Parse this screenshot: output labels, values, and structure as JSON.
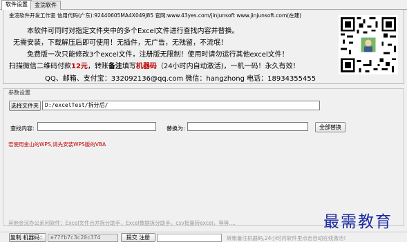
{
  "tabs": [
    {
      "label": "软件设置",
      "active": true
    },
    {
      "label": "金浣软件",
      "active": false
    }
  ],
  "info": {
    "header": "金浣软件开发工作室   信用代码(广东):92440605MA4X049J85  官网:www.43yes.com/jinjunsoft   www.jinjunsoft.com(在建)",
    "line1": "本软件可同时对指定文件夹中的多个Excel文件进行查找内容并替换。",
    "line2": "无需安装，下载解压后即可使用！无插件，无广告，无残留，不流氓！",
    "line3": "免费版一次只能修改3个excel文件，注册版无限制！使用时请勿运行其他excel文件！",
    "line4_prefix": "扫描微信二维码付款",
    "line4_price": "12元",
    "line4_middle": "，转账",
    "line4_note": "备注",
    "line4_after_note": "填写",
    "line4_machine": "机器码",
    "line4_suffix": "（24小时内自动激活)，一机一码！永久有效！",
    "line5": "QQ、邮箱、支付宝：332092136@qq.com      微信：hangzhong      电话：18934355455"
  },
  "params": {
    "group_title": "参数设置",
    "select_folder_label": "选择文件夹",
    "folder_path": "D:/excelTest/拆分后/",
    "find_label": "查找内容:",
    "find_value": "",
    "replace_label": "替换为:",
    "replace_value": "",
    "replace_all_label": "全部替换",
    "warning": "若使用金山的WPS,请先安装WPS版的VBA"
  },
  "other_software": "其他金浣办公系列软件：Excel文件合并拆分助手，Excel数据拆分助手，csv批量转excel，等等....",
  "watermark": "最需教育",
  "statusbar": {
    "copy_machine_label": "复制 机器码：",
    "machine_code": "e77fb7c3c20c374",
    "submit_code_label": "提交 注册码：",
    "register_code": "",
    "status_text": "转账备注机器码,24小时内软件里点击自动在线激活!"
  },
  "colors": {
    "red_text": "#c00000",
    "watermark": "#1a2aa0"
  }
}
